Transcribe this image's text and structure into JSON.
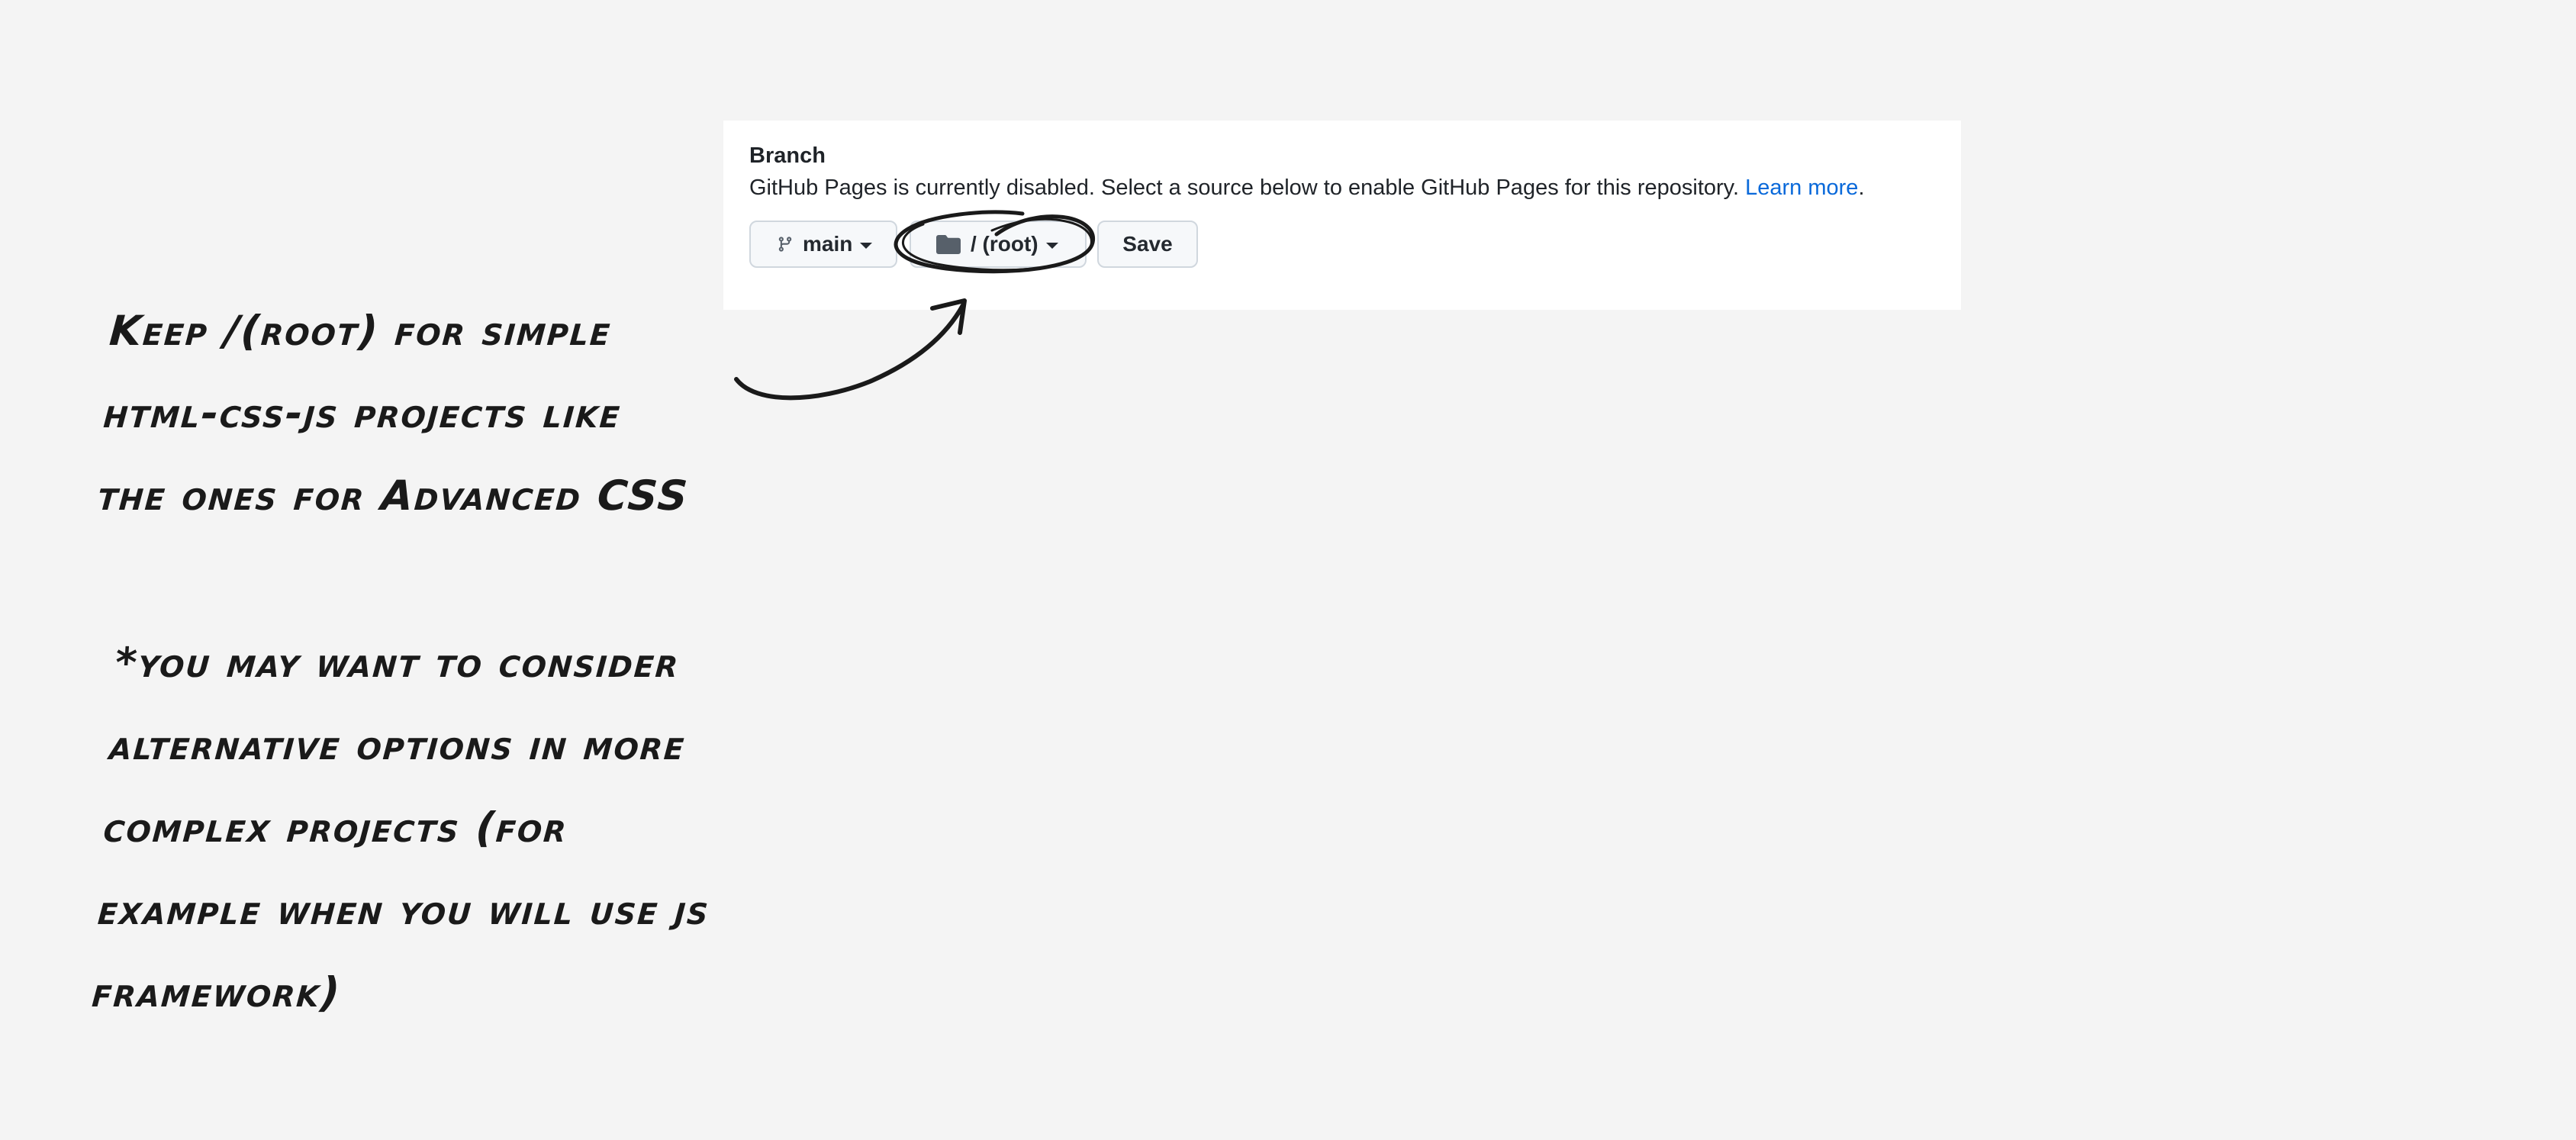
{
  "pages_settings": {
    "branch_title": "Branch",
    "description": "GitHub Pages is currently disabled. Select a source below to enable GitHub Pages for this repository.",
    "learn_more_label": "Learn more",
    "trailing_period": ".",
    "branch_button_label": "main",
    "folder_button_label": "/ (root)",
    "save_button_label": "Save",
    "link_color": "#0969da",
    "branch_icon": "git-branch-icon",
    "folder_icon": "folder-icon"
  },
  "annotation": {
    "note_lines": [
      "Keep /(root) for simple",
      "html-css-js projects like",
      "the ones for Advanced CSS"
    ],
    "footnote_lines": [
      "*you may want to consider",
      "alternative options in more",
      "complex projects (for",
      "example when you will use js",
      "framework)"
    ]
  }
}
